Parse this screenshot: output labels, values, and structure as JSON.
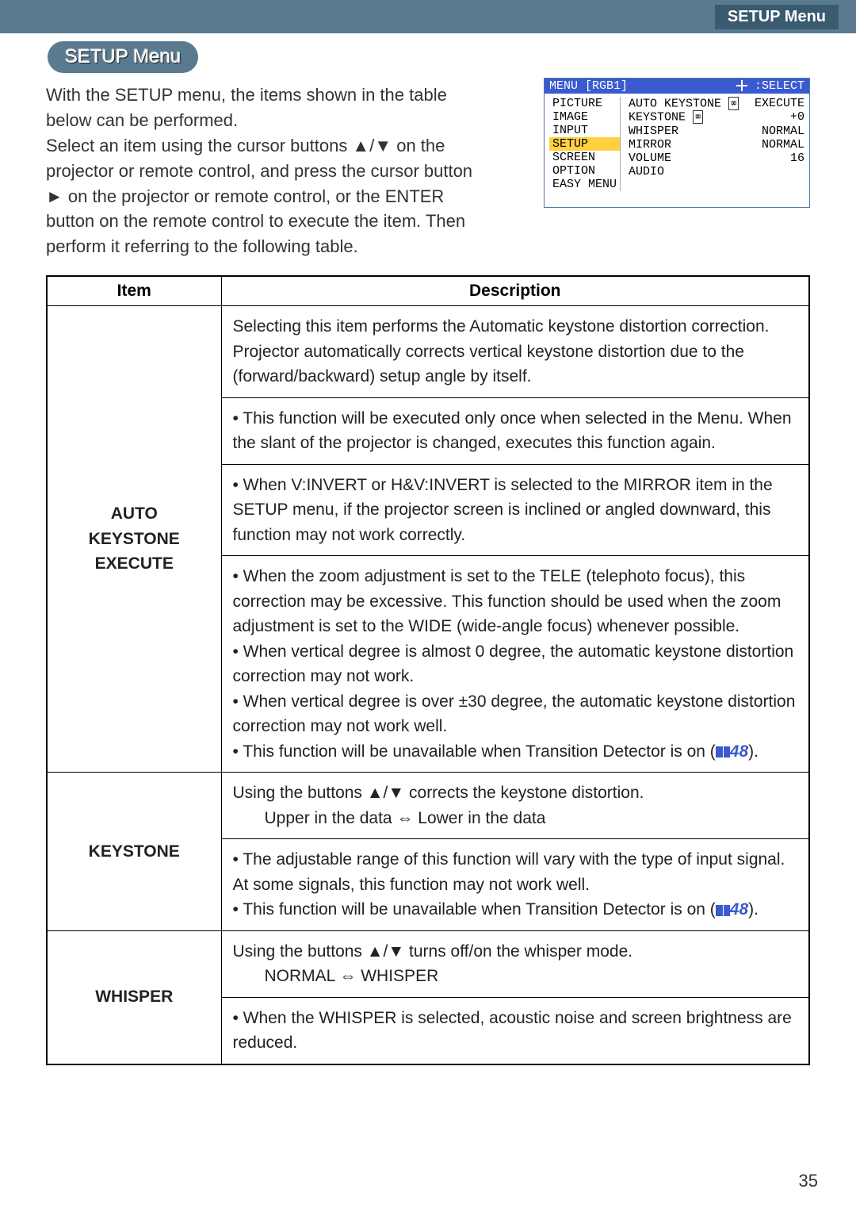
{
  "header": {
    "section": "SETUP Menu"
  },
  "title": "SETUP Menu",
  "intro": {
    "p1": "With the SETUP menu, the items shown in the table below can be performed.",
    "p2": "Select an item using the cursor buttons ▲/▼ on the projector or remote control, and press the cursor button ► on the projector or remote control, or the ENTER button on the remote control to execute the item. Then perform it referring to the following table."
  },
  "menu_panel": {
    "head_left": "MENU [RGB1]",
    "head_right": ":SELECT",
    "left_items": [
      "PICTURE",
      "IMAGE",
      "INPUT",
      "SETUP",
      "SCREEN",
      "OPTION",
      "EASY MENU"
    ],
    "highlight_index": 3,
    "right_rows": [
      {
        "label": "AUTO KEYSTONE",
        "icon": "⌧",
        "value": "EXECUTE"
      },
      {
        "label": "KEYSTONE",
        "icon": "⌧",
        "value": "+0"
      },
      {
        "label": "WHISPER",
        "icon": "",
        "value": "NORMAL"
      },
      {
        "label": "MIRROR",
        "icon": "",
        "value": "NORMAL"
      },
      {
        "label": "VOLUME",
        "icon": "",
        "value": "16"
      },
      {
        "label": "AUDIO",
        "icon": "",
        "value": ""
      }
    ]
  },
  "table": {
    "headers": {
      "item": "Item",
      "desc": "Description"
    },
    "rows": [
      {
        "item": "AUTO\nKEYSTONE\nEXECUTE",
        "desc": {
          "p1": "Selecting this item performs the Automatic keystone distortion correction. Projector automatically corrects vertical keystone distortion due to the (forward/backward) setup angle by itself.",
          "p2": "• This function will be executed only once when selected in the Menu. When the slant of the projector is changed, executes this function again.",
          "p3": "• When V:INVERT or H&V:INVERT is selected to the MIRROR item in the SETUP menu, if the projector screen is inclined or angled downward, this function may not work correctly.",
          "p4": "• When the zoom adjustment is set to the TELE (telephoto focus), this correction may be excessive. This function should be used when the zoom adjustment is set to the WIDE (wide-angle focus) whenever possible.",
          "p5": "• When vertical degree is almost 0 degree, the automatic keystone distortion correction may not work.",
          "p6": "• When vertical degree is over ±30 degree, the automatic keystone distortion correction may not work well.",
          "p7a": "• This function will be unavailable when Transition Detector is on (",
          "p7b": "48",
          "p7c": ")."
        }
      },
      {
        "item": "KEYSTONE",
        "desc": {
          "p1": "Using the buttons ▲/▼ corrects the keystone distortion.",
          "p2": "Upper in the data ⇔ Lower in the data",
          "p3": "• The adjustable range of this function will vary with the type of input signal. At some signals, this function may not work well.",
          "p4a": "• This function will be unavailable when Transition Detector is on (",
          "p4b": "48",
          "p4c": ")."
        }
      },
      {
        "item": "WHISPER",
        "desc": {
          "p1": "Using the buttons ▲/▼ turns off/on the whisper mode.",
          "p2": "NORMAL ⇔ WHISPER",
          "p3": "• When the WHISPER is selected, acoustic noise and screen brightness are reduced."
        }
      }
    ]
  },
  "pagenum": "35"
}
